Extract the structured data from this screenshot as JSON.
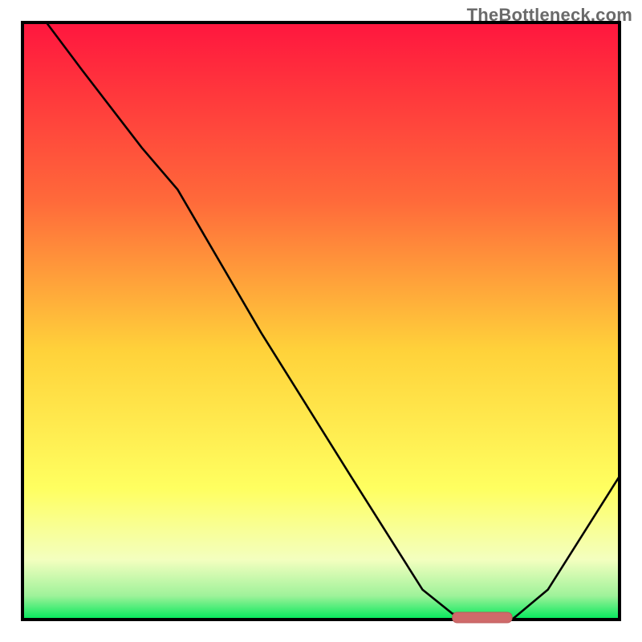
{
  "watermark": "TheBottleneck.com",
  "colors": {
    "frame": "#000000",
    "curve": "#000000",
    "marker_fill": "#cf6a6a",
    "marker_stroke": "#bd5a5a",
    "grad_top": "#ff163e",
    "grad_mid1": "#ff8a3a",
    "grad_mid2": "#ffe63a",
    "grad_mid3": "#ffff9a",
    "grad_mid4": "#d8ffb8",
    "grad_bottom": "#00e85a"
  },
  "chart_data": {
    "type": "line",
    "title": "",
    "xlabel": "",
    "ylabel": "",
    "xlim": [
      0,
      100
    ],
    "ylim": [
      0,
      100
    ],
    "grid": false,
    "legend": false,
    "background_gradient": {
      "orientation": "vertical",
      "stops": [
        {
          "offset": 0.0,
          "color": "#ff163e"
        },
        {
          "offset": 0.3,
          "color": "#ff6a3a"
        },
        {
          "offset": 0.55,
          "color": "#ffd23a"
        },
        {
          "offset": 0.78,
          "color": "#ffff60"
        },
        {
          "offset": 0.9,
          "color": "#f3ffbf"
        },
        {
          "offset": 0.96,
          "color": "#9ff29a"
        },
        {
          "offset": 1.0,
          "color": "#00e85a"
        }
      ]
    },
    "series": [
      {
        "name": "bottleneck-curve",
        "x": [
          4,
          10,
          20,
          26,
          40,
          55,
          67,
          72,
          78,
          82,
          88,
          100
        ],
        "y": [
          100,
          92,
          79,
          72,
          48,
          24,
          5,
          1,
          0,
          0,
          5,
          24
        ]
      }
    ],
    "marker": {
      "name": "optimal-range",
      "x_start": 72,
      "x_end": 82,
      "y": 0
    }
  }
}
